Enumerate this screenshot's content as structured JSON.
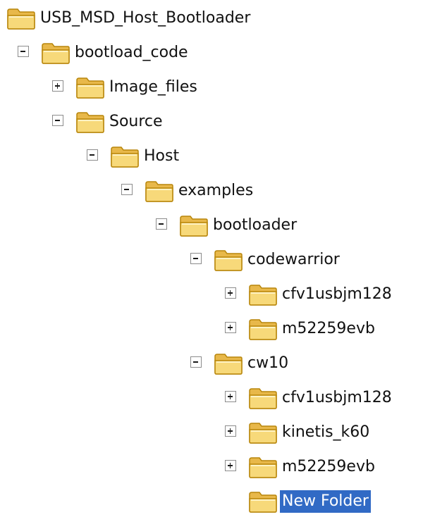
{
  "colors": {
    "selection_bg": "#316ac5",
    "selection_text": "#ffffff",
    "folder_fill": "#f7d97a",
    "folder_stroke": "#b8860b"
  },
  "tree": {
    "nodes": [
      {
        "label": "USB_MSD_Host_Bootloader",
        "depth": 0,
        "toggle": "none",
        "icon": "folder-icon"
      },
      {
        "label": "bootload_code",
        "depth": 1,
        "toggle": "expanded",
        "icon": "folder-icon"
      },
      {
        "label": "Image_files",
        "depth": 2,
        "toggle": "collapsed",
        "icon": "folder-icon"
      },
      {
        "label": "Source",
        "depth": 2,
        "toggle": "expanded",
        "icon": "folder-icon"
      },
      {
        "label": "Host",
        "depth": 3,
        "toggle": "expanded",
        "icon": "folder-icon"
      },
      {
        "label": "examples",
        "depth": 4,
        "toggle": "expanded",
        "icon": "folder-icon"
      },
      {
        "label": "bootloader",
        "depth": 5,
        "toggle": "expanded",
        "icon": "folder-icon"
      },
      {
        "label": "codewarrior",
        "depth": 6,
        "toggle": "expanded",
        "icon": "folder-icon"
      },
      {
        "label": "cfv1usbjm128",
        "depth": 7,
        "toggle": "collapsed",
        "icon": "folder-icon"
      },
      {
        "label": "m52259evb",
        "depth": 7,
        "toggle": "collapsed",
        "icon": "folder-icon"
      },
      {
        "label": "cw10",
        "depth": 6,
        "toggle": "expanded",
        "icon": "folder-icon"
      },
      {
        "label": "cfv1usbjm128",
        "depth": 7,
        "toggle": "collapsed",
        "icon": "folder-icon"
      },
      {
        "label": "kinetis_k60",
        "depth": 7,
        "toggle": "collapsed",
        "icon": "folder-icon"
      },
      {
        "label": "m52259evb",
        "depth": 7,
        "toggle": "collapsed",
        "icon": "folder-icon"
      },
      {
        "label": "New Folder",
        "depth": 7,
        "toggle": "none",
        "icon": "folder-icon",
        "selected": true
      }
    ]
  }
}
